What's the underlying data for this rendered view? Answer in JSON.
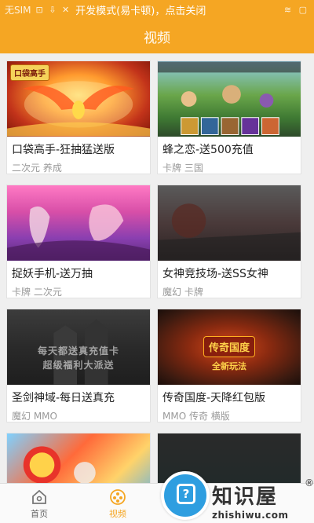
{
  "status_bar": {
    "carrier": "无SIM",
    "dev_mode_text": "开发模式(易卡顿)，点击关闭"
  },
  "app_bar": {
    "title": "视频"
  },
  "videos": [
    {
      "title": "口袋高手-狂抽猛送版",
      "tags": "二次元 养成",
      "logo": "口袋高手"
    },
    {
      "title": "蜂之恋-送500充值",
      "tags": "卡牌 三国"
    },
    {
      "title": "捉妖手机-送万抽",
      "tags": "卡牌 二次元"
    },
    {
      "title": "女神竞技场-送SS女神",
      "tags": "魔幻 卡牌"
    },
    {
      "title": "圣剑神域-每日送真充",
      "tags": "魔幻 MMO",
      "watermark": "每天都送真充值卡",
      "watermark2": "超级福利大派送"
    },
    {
      "title": "传奇国度-天降红包版",
      "tags": "MMO 传奇 横版",
      "emblem": "传奇国度",
      "tagline": "全新玩法"
    },
    {
      "title": "",
      "tags": ""
    },
    {
      "title": "",
      "tags": ""
    }
  ],
  "tabs": [
    {
      "label": "首页",
      "icon": "home-icon",
      "active": false
    },
    {
      "label": "视频",
      "icon": "video-icon",
      "active": true
    }
  ],
  "watermark_site": {
    "name_cn": "知识屋",
    "name_en": "zhishiwu.com",
    "reg": "®"
  },
  "colors": {
    "accent": "#f5a623",
    "tab_active": "#f5a623",
    "badge": "#2e9ee0"
  }
}
